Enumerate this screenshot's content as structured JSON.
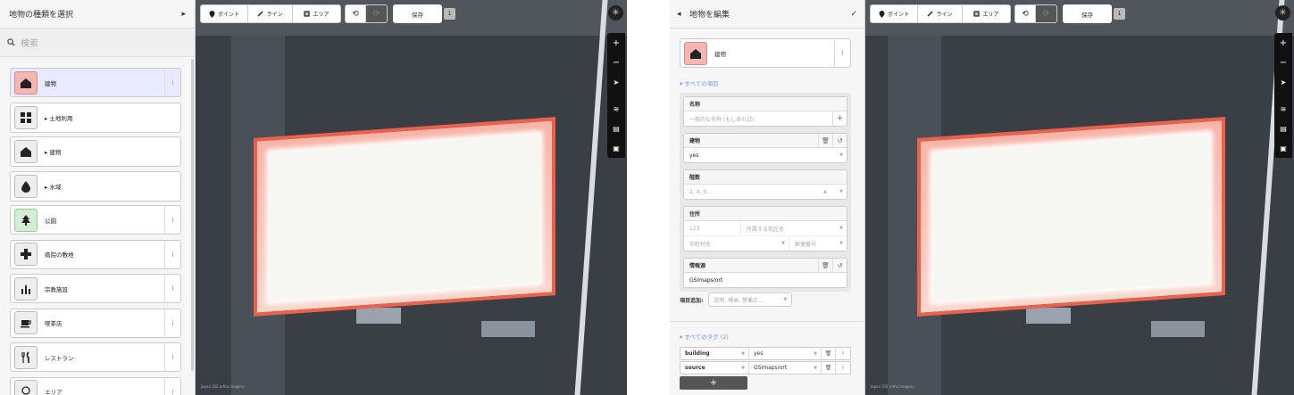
{
  "left_sidebar": {
    "title": "地物の種類を選択",
    "forward_arrow": "▸",
    "search_placeholder": "検索",
    "presets": [
      {
        "label": "建物",
        "icon": "building-icon",
        "info": "i",
        "selected": true
      },
      {
        "label": "▸ 土地利用",
        "icon": "landuse-icon",
        "category": true
      },
      {
        "label": "▸ 建物",
        "icon": "building-icon",
        "category": true
      },
      {
        "label": "▸ 水域",
        "icon": "water-icon",
        "category": true
      },
      {
        "label": "公園",
        "icon": "tree-icon",
        "info": "i"
      },
      {
        "label": "病院の敷地",
        "icon": "hospital-icon",
        "info": "i"
      },
      {
        "label": "宗教施設",
        "icon": "place-of-worship-icon",
        "info": "i"
      },
      {
        "label": "喫茶店",
        "icon": "cafe-icon",
        "info": "i"
      },
      {
        "label": "レストラン",
        "icon": "restaurant-icon",
        "info": "i"
      },
      {
        "label": "エリア",
        "icon": "area-icon",
        "info": "i"
      }
    ]
  },
  "toolbar": {
    "point": "ポイント",
    "line": "ライン",
    "area": "エリア",
    "undo_icon": "undo-icon",
    "redo_icon": "redo-icon",
    "save": "保存",
    "edit_count": "1"
  },
  "map_controls": {
    "zoom_in": "+",
    "zoom_out": "−",
    "geolocate_icon": "geolocate-icon",
    "layers_icon": "layers-icon",
    "map_data_icon": "map-data-icon",
    "help_icon": "help-icon"
  },
  "attribution": "Japan GSI ortho imagery",
  "editor": {
    "back": "◂",
    "title": "地物を編集",
    "done": "✓",
    "preset_label": "建物",
    "preset_info": "i",
    "all_fields_link": "▾ すべての項目",
    "fields": {
      "name_label": "名称",
      "name_placeholder": "一般的な名称 (もしあれば)",
      "building_label": "建物",
      "building_value": "yes",
      "levels_label": "階数",
      "levels_placeholder": "2, 4, 6...",
      "address_label": "住所",
      "addr_housenumber": "123",
      "addr_street": "所属する街区名",
      "addr_city": "市町村名",
      "addr_postcode": "郵便番号",
      "source_label": "情報源",
      "source_value": "GSImaps/ort"
    },
    "add_field_label": "項目追加:",
    "add_field_placeholder": "説明, 標高, 警備正...",
    "all_tags_link": "▾ すべてのタグ (2)",
    "tags": [
      {
        "key": "building",
        "value": "yes"
      },
      {
        "key": "source",
        "value": "GSImaps/ort"
      }
    ],
    "add_tag": "+"
  },
  "colors": {
    "selection_outline": "#e8624d",
    "accent_link": "#7092ff",
    "selected_preset_bg": "#e8ebff"
  }
}
